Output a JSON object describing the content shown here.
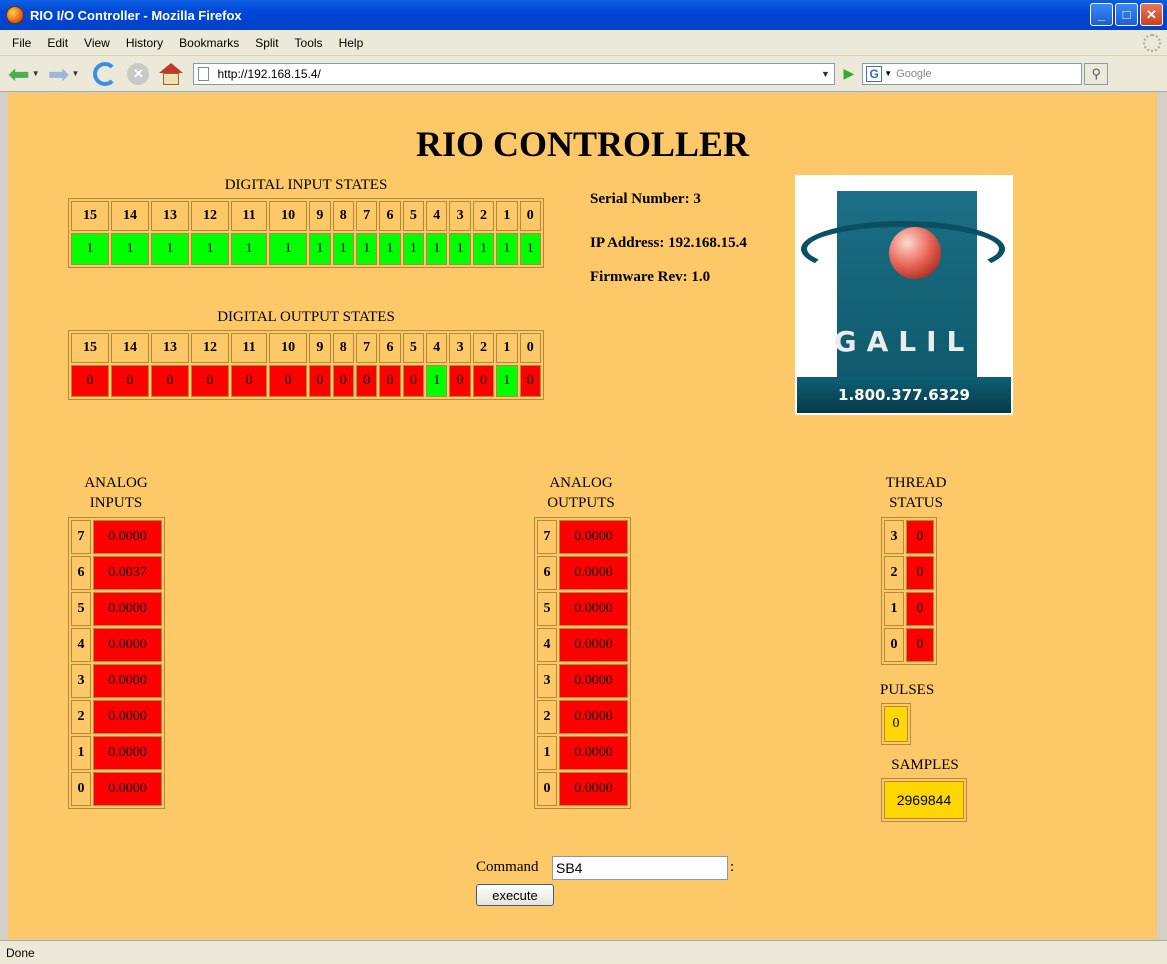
{
  "window": {
    "title": "RIO I/O Controller - Mozilla Firefox"
  },
  "menu": [
    "File",
    "Edit",
    "View",
    "History",
    "Bookmarks",
    "Split",
    "Tools",
    "Help"
  ],
  "nav": {
    "url": "http://192.168.15.4/",
    "search_placeholder": "Google"
  },
  "page": {
    "title": "RIO CONTROLLER",
    "digital_inputs": {
      "caption": "DIGITAL INPUT STATES",
      "bits": [
        "15",
        "14",
        "13",
        "12",
        "11",
        "10",
        "9",
        "8",
        "7",
        "6",
        "5",
        "4",
        "3",
        "2",
        "1",
        "0"
      ],
      "states": [
        1,
        1,
        1,
        1,
        1,
        1,
        1,
        1,
        1,
        1,
        1,
        1,
        1,
        1,
        1,
        1
      ]
    },
    "digital_outputs": {
      "caption": "DIGITAL OUTPUT STATES",
      "bits": [
        "15",
        "14",
        "13",
        "12",
        "11",
        "10",
        "9",
        "8",
        "7",
        "6",
        "5",
        "4",
        "3",
        "2",
        "1",
        "0"
      ],
      "states": [
        0,
        0,
        0,
        0,
        0,
        0,
        0,
        0,
        0,
        0,
        0,
        1,
        0,
        0,
        1,
        0
      ]
    },
    "info": {
      "serial": "Serial Number: 3",
      "ip": "IP Address: 192.168.15.4",
      "firmware": "Firmware Rev: 1.0"
    },
    "logo": {
      "word": "GALIL",
      "phone": "1.800.377.6329"
    },
    "analog_inputs": {
      "caption_line1": "ANALOG",
      "caption_line2": "INPUTS",
      "rows": [
        {
          "ch": "7",
          "value": "0.0000"
        },
        {
          "ch": "6",
          "value": "0.0037"
        },
        {
          "ch": "5",
          "value": "0.0000"
        },
        {
          "ch": "4",
          "value": "0.0000"
        },
        {
          "ch": "3",
          "value": "0.0000"
        },
        {
          "ch": "2",
          "value": "0.0000"
        },
        {
          "ch": "1",
          "value": "0.0000"
        },
        {
          "ch": "0",
          "value": "0.0000"
        }
      ]
    },
    "analog_outputs": {
      "caption_line1": "ANALOG",
      "caption_line2": "OUTPUTS",
      "rows": [
        {
          "ch": "7",
          "value": "0.0000"
        },
        {
          "ch": "6",
          "value": "0.0000"
        },
        {
          "ch": "5",
          "value": "0.0000"
        },
        {
          "ch": "4",
          "value": "0.0000"
        },
        {
          "ch": "3",
          "value": "0.0000"
        },
        {
          "ch": "2",
          "value": "0.0000"
        },
        {
          "ch": "1",
          "value": "0.0000"
        },
        {
          "ch": "0",
          "value": "0.0000"
        }
      ]
    },
    "threads": {
      "caption_line1": "THREAD",
      "caption_line2": "STATUS",
      "rows": [
        {
          "ch": "3",
          "value": "0"
        },
        {
          "ch": "2",
          "value": "0"
        },
        {
          "ch": "1",
          "value": "0"
        },
        {
          "ch": "0",
          "value": "0"
        }
      ]
    },
    "pulses": {
      "caption": "PULSES",
      "value": "0"
    },
    "samples": {
      "caption": "SAMPLES",
      "value": "2969844"
    },
    "command": {
      "label": "Command",
      "value": "SB4",
      "colon": ":",
      "button": "execute"
    }
  },
  "status": {
    "text": "Done"
  },
  "colors": {
    "page_bg": "#fdc868",
    "on": "#00ff00",
    "off": "#ff0000",
    "counter": "#ffd700"
  }
}
